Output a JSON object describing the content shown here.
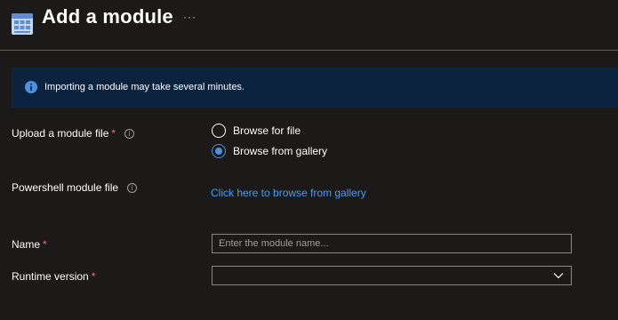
{
  "header": {
    "title": "Add a module",
    "more_label": "···"
  },
  "info": {
    "message": "Importing a module may take several minutes."
  },
  "form": {
    "upload": {
      "label": "Upload a module file",
      "required_mark": "*",
      "help_glyph": "i",
      "options": [
        {
          "label": "Browse for file",
          "selected": false
        },
        {
          "label": "Browse from gallery",
          "selected": true
        }
      ]
    },
    "powershell": {
      "label": "Powershell module file",
      "help_glyph": "i",
      "link_text": "Click here to browse from gallery"
    },
    "name": {
      "label": "Name",
      "required_mark": "*",
      "value": "",
      "placeholder": "Enter the module name..."
    },
    "runtime": {
      "label": "Runtime version",
      "required_mark": "*",
      "selected_value": ""
    }
  },
  "colors": {
    "background": "#1b1a19",
    "accent": "#4f8fe0",
    "link": "#479ef5",
    "banner": "#0c2340",
    "required": "#f1707b"
  }
}
